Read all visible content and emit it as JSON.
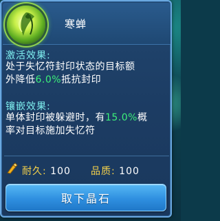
{
  "item": {
    "name": "寒蝉",
    "icon": "cicada-icon"
  },
  "activation": {
    "title": "激活效果:",
    "line1": "处于失忆符封印状态的目标额",
    "line2_prefix": "外降低",
    "line2_value": "6.0%",
    "line2_suffix": "抵抗封印"
  },
  "inlay": {
    "title": "镶嵌效果:",
    "line1_prefix": "单体封印被躲避时，有",
    "line1_value": "15.0%",
    "line1_suffix": "概",
    "line2": "率对目标施加失忆符"
  },
  "stats": {
    "icon": "durability-icon",
    "durability_label": "耐久:",
    "durability_value": "100",
    "quality_label": "品质:",
    "quality_value": "100"
  },
  "actions": {
    "remove_label": "取下晶石"
  },
  "colors": {
    "section_title": "#7ff0f0",
    "highlight": "#3df07a",
    "stat_label": "#f5d24b",
    "button": "#2f8fe0"
  }
}
